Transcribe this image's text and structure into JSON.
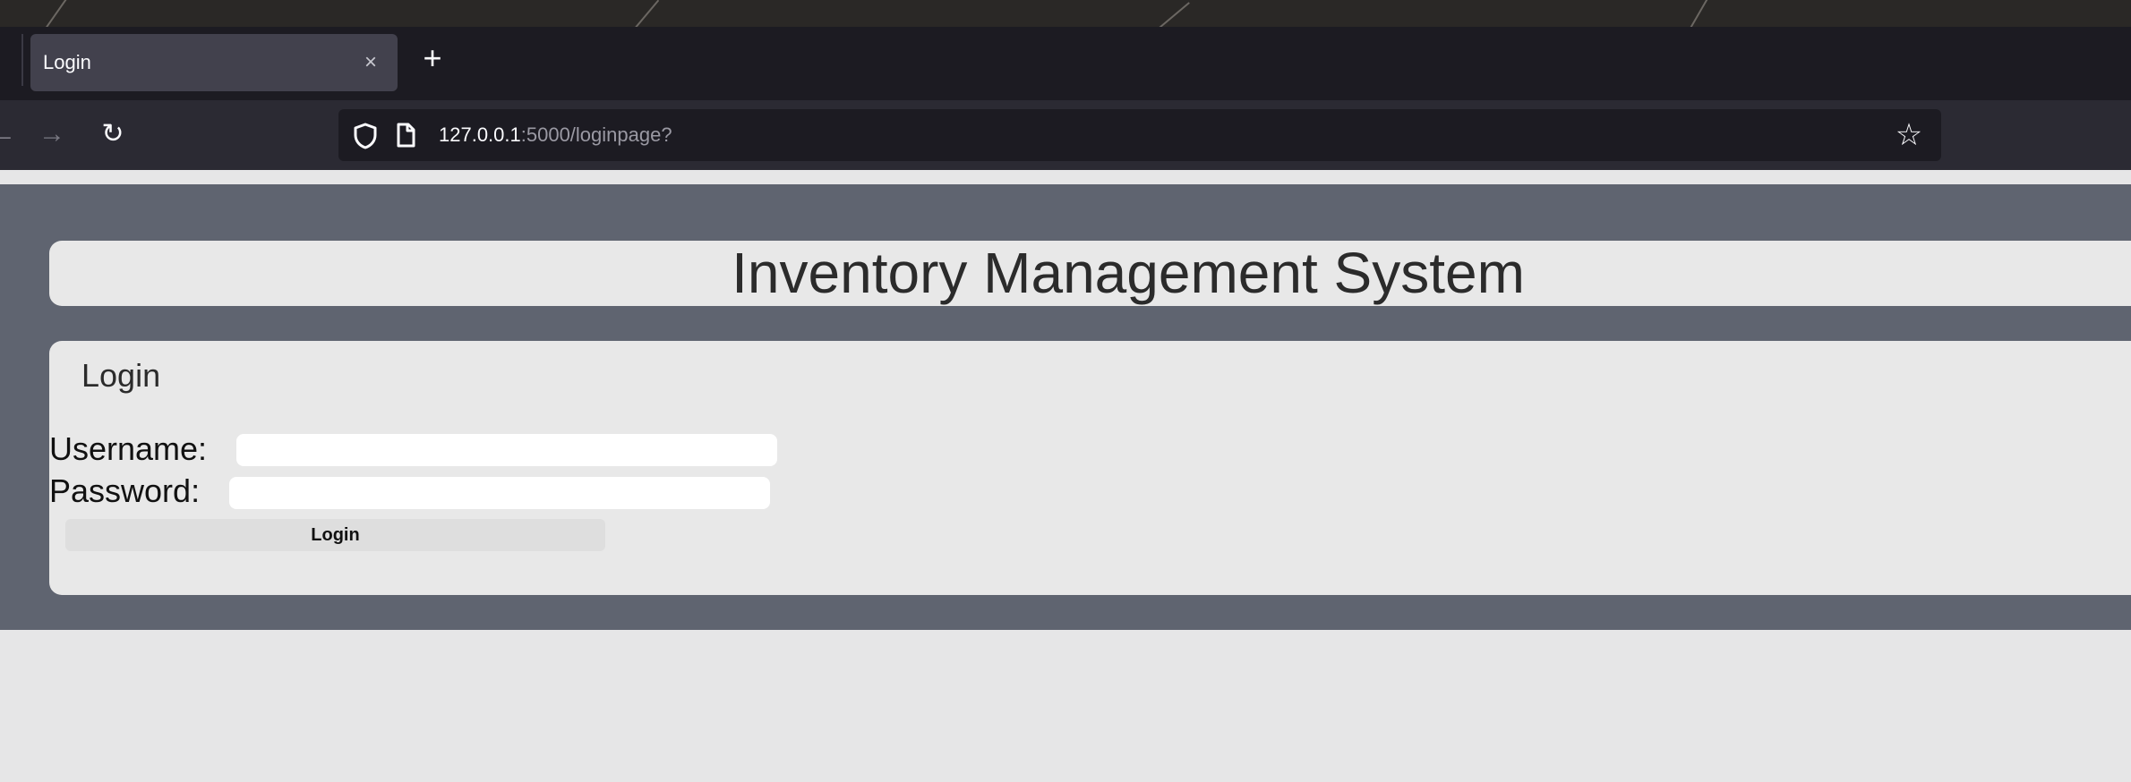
{
  "browser": {
    "tab": {
      "title": "Login",
      "close_glyph": "×"
    },
    "new_tab_glyph": "+",
    "nav": {
      "back_glyph": "←",
      "forward_glyph": "→",
      "reload_glyph": "↻"
    },
    "address": {
      "host": "127.0.0.1",
      "rest": ":5000/loginpage?",
      "bookmark_glyph": "☆"
    },
    "icons": [
      "close-icon",
      "plus-icon",
      "back-arrow-icon",
      "forward-arrow-icon",
      "reload-icon",
      "shield-icon",
      "page-icon",
      "star-icon"
    ]
  },
  "page": {
    "title": "Inventory Management System",
    "login": {
      "heading": "Login",
      "username_label": "Username:",
      "username_value": "",
      "password_label": "Password:",
      "password_value": "",
      "button_label": "Login"
    }
  },
  "colors": {
    "tab_bar": "#1c1b22",
    "active_tab": "#42414d",
    "nav_bar": "#2b2a33",
    "page_band": "#5f6470",
    "panel": "#e8e8e8",
    "page_background": "#e6e6e7"
  }
}
